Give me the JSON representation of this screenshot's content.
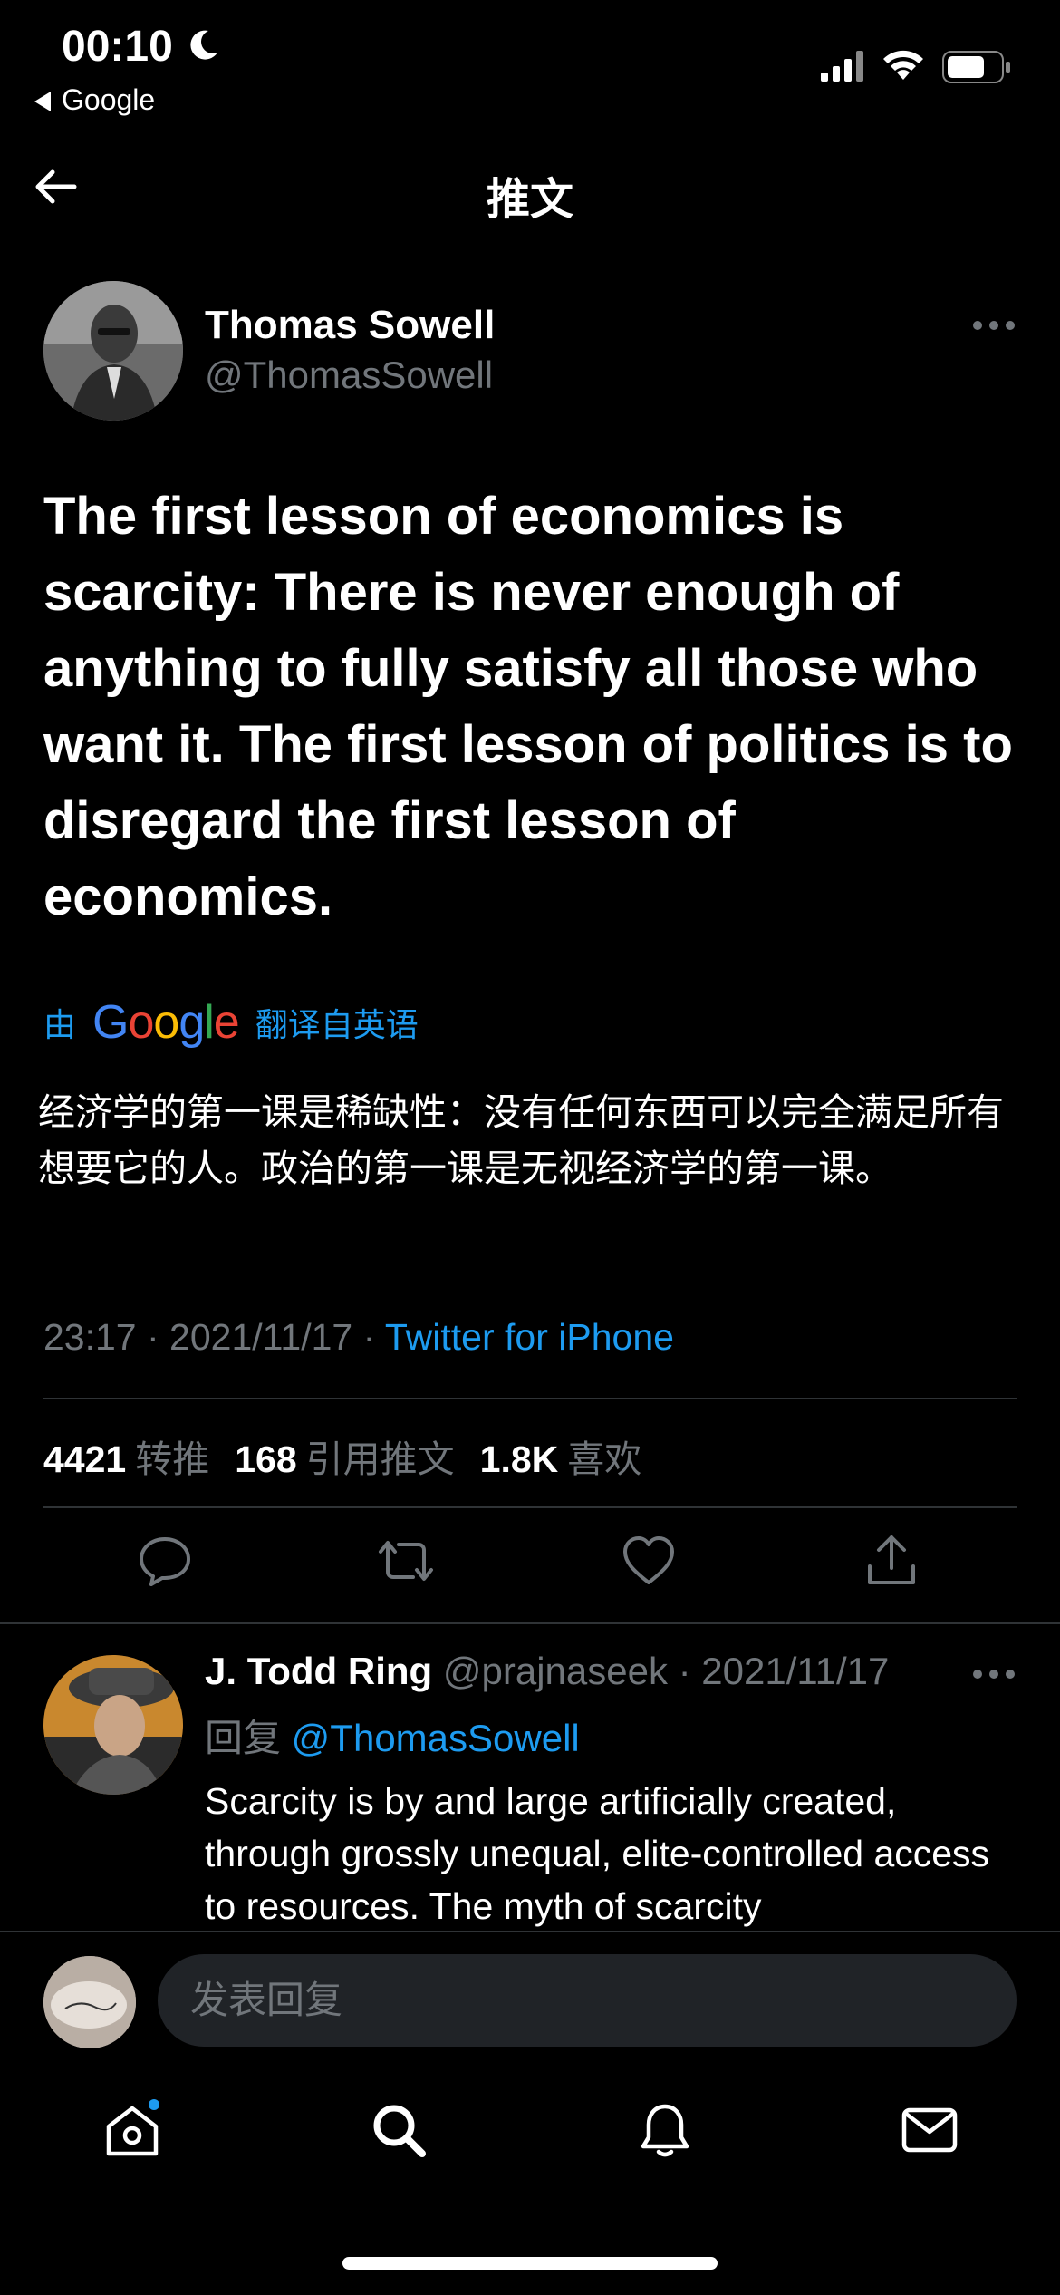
{
  "status_bar": {
    "time": "00:10",
    "back_app": "Google"
  },
  "header": {
    "title": "推文"
  },
  "tweet": {
    "author_name": "Thomas Sowell",
    "author_handle": "@ThomasSowell",
    "text": "The first lesson of economics is scarcity: There is never enough of anything to fully satisfy all those who want it. The first lesson of politics is to disregard the first lesson of economics.",
    "translate_prefix": "由",
    "translate_brand": "Google",
    "translate_suffix": "翻译自英语",
    "translated_text": "经济学的第一课是稀缺性：没有任何东西可以完全满足所有想要它的人。政治的第一课是无视经济学的第一课。",
    "time_date": "23:17 · 2021/11/17 · ",
    "source": "Twitter for iPhone",
    "stats": {
      "retweets_count": "4421",
      "retweets_label": "转推",
      "quotes_count": "168",
      "quotes_label": "引用推文",
      "likes_count": "1.8K",
      "likes_label": "喜欢"
    }
  },
  "reply": {
    "name": "J. Todd Ring",
    "handle_date": " @prajnaseek · 2021/11/17",
    "reply_prefix": "回复 ",
    "reply_to": "@ThomasSowell",
    "text": "Scarcity is by and large artificially created, through grossly unequal, elite-controlled access to resources. The myth of scarcity"
  },
  "composer": {
    "placeholder": "发表回复"
  },
  "colors": {
    "accent": "#1d9bf0",
    "muted": "#71767b",
    "background": "#000000"
  },
  "icons": [
    "moon-icon",
    "signal-icon",
    "wifi-icon",
    "battery-icon",
    "back-arrow-icon",
    "more-icon",
    "reply-icon",
    "retweet-icon",
    "like-icon",
    "share-icon",
    "home-icon",
    "search-icon",
    "notifications-icon",
    "messages-icon"
  ]
}
